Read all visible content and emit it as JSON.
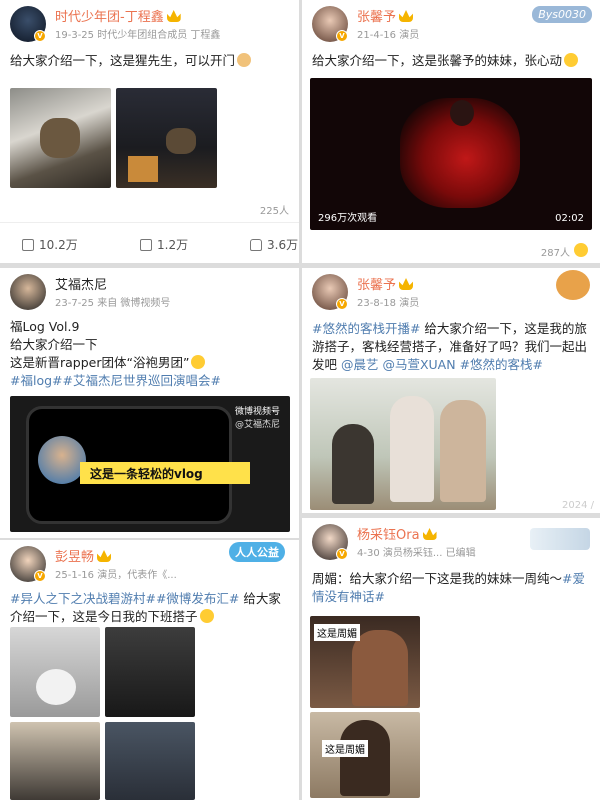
{
  "posts": [
    {
      "name": "时代少年团-丁程鑫",
      "meta": "19-3-25  时代少年团组合成员 丁程鑫",
      "text": "给大家介绍一下，这是猩先生，可以开门",
      "likes_small": "225人",
      "reposts": "10.2万",
      "comments": "1.2万",
      "likes": "3.6万"
    },
    {
      "name": "张馨予",
      "meta": "21-4-16  演员",
      "text": "给大家介绍一下，这是张馨予的妹妹，张心动",
      "video_views": "296万次观看",
      "video_duration": "02:02",
      "likes_small": "287人",
      "watermark": "Bys0030"
    },
    {
      "name": "艾福杰尼",
      "meta": "23-7-25  来自 微博视频号",
      "line1": "福Log Vol.9",
      "line2": "给大家介绍一下",
      "line3": "这是新晋rapper团体“浴袍男团”",
      "tags": "#福log##艾福杰尼世界巡回演唱会#",
      "video_caption": "这是一条轻松的vlog",
      "video_logo": "微博视频号",
      "video_user": "@艾福杰尼"
    },
    {
      "name": "张馨予",
      "meta": "23-8-18  演员",
      "text_tag": "#悠然的客栈开播#",
      "text_a": " 给大家介绍一下，这是我的旅游搭子，客栈经营搭子，准备好了吗？我们一起出发吧 ",
      "mention1": "@晨艺",
      "mention2": " @马萱XUAN",
      "tag2": " #悠然的客栈#",
      "corner": "2024 /"
    },
    {
      "name": "彭昱畅",
      "meta": "25-1-16  演员，代表作《...",
      "tag1": "#异人之下之决战碧游村##微博发布汇#",
      "text": " 给大家介绍一下，这是今日我的下班搭子",
      "badge": "人人公益"
    },
    {
      "name": "杨采钰Ora",
      "meta": "4-30  演员杨采钰...  已编辑",
      "text": "周媚：给大家介绍一下这是我的妹妹一周纯～",
      "tag": "#爱情没有神话#",
      "label1": "这是周媚",
      "label2": "这是周媚"
    }
  ],
  "colors": {
    "name": "#eb7350",
    "link": "#507daf",
    "vip": "#f5b400"
  }
}
